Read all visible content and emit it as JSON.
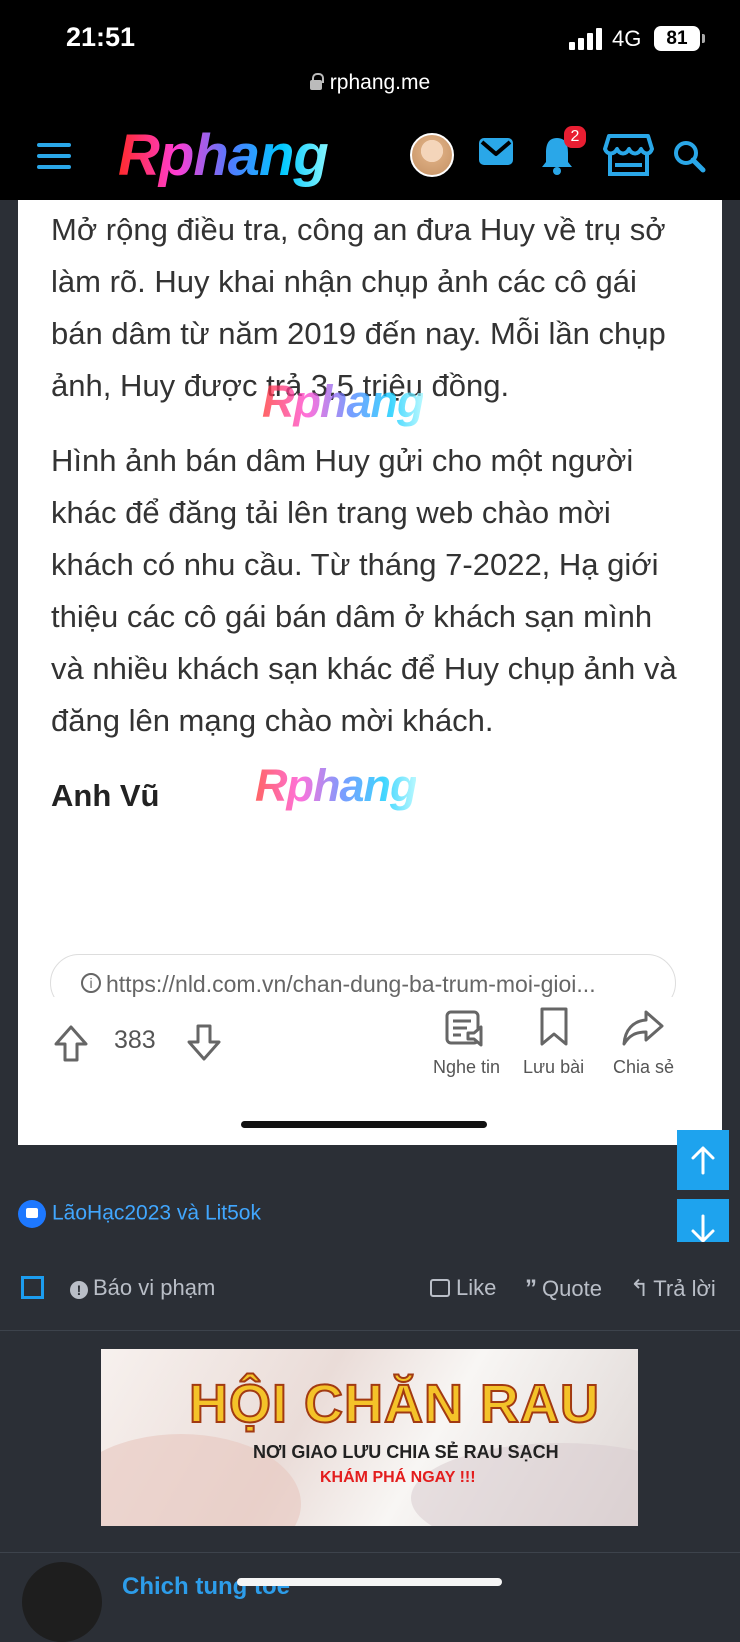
{
  "status": {
    "time": "21:51",
    "network": "4G",
    "battery": "81"
  },
  "browser": {
    "url": "rphang.me"
  },
  "header": {
    "logo": "Rphang",
    "notification_count": "2"
  },
  "article": {
    "paragraphs": [
      "Mở rộng điều tra, công an đưa Huy về trụ sở làm rõ. Huy khai nhận chụp ảnh các cô gái bán dâm từ năm 2019 đến nay. Mỗi lần chụp ảnh, Huy được trả 3,5 triệu đồng.",
      "Hình ảnh bán dâm Huy gửi cho một người khác để đăng tải lên trang web chào mời khách có nhu cầu. Từ tháng 7-2022, Hạ giới thiệu các cô gái bán dâm ở khách sạn mình và nhiều khách sạn khác để Huy chụp ảnh và đăng lên mạng chào mời khách."
    ],
    "author": "Anh Vũ",
    "source_url": "https://nld.com.vn/chan-dung-ba-trum-moi-gioi...",
    "watermark": "Rphang",
    "vote_count": "383",
    "actions": {
      "listen": "Nghe tin",
      "save": "Lưu bài",
      "share": "Chia sẻ"
    }
  },
  "reactions": {
    "users": "LãoHạc2023 và Lit5ok"
  },
  "post_actions": {
    "report": "Báo vi phạm",
    "like": "Like",
    "quote": "Quote",
    "reply": "Trả lời"
  },
  "ad": {
    "title": "HỘI CHĂN RAU",
    "subtitle": "NƠI GIAO LƯU CHIA SẺ RAU SẠCH",
    "cta": "KHÁM PHÁ NGAY !!!"
  },
  "next_post": {
    "username": "Chich tung toe"
  },
  "colors": {
    "accent": "#1ea3ee",
    "dark_background": "#2b2f36",
    "link_blue": "#41a7ff",
    "notification_red": "#e91e32"
  }
}
